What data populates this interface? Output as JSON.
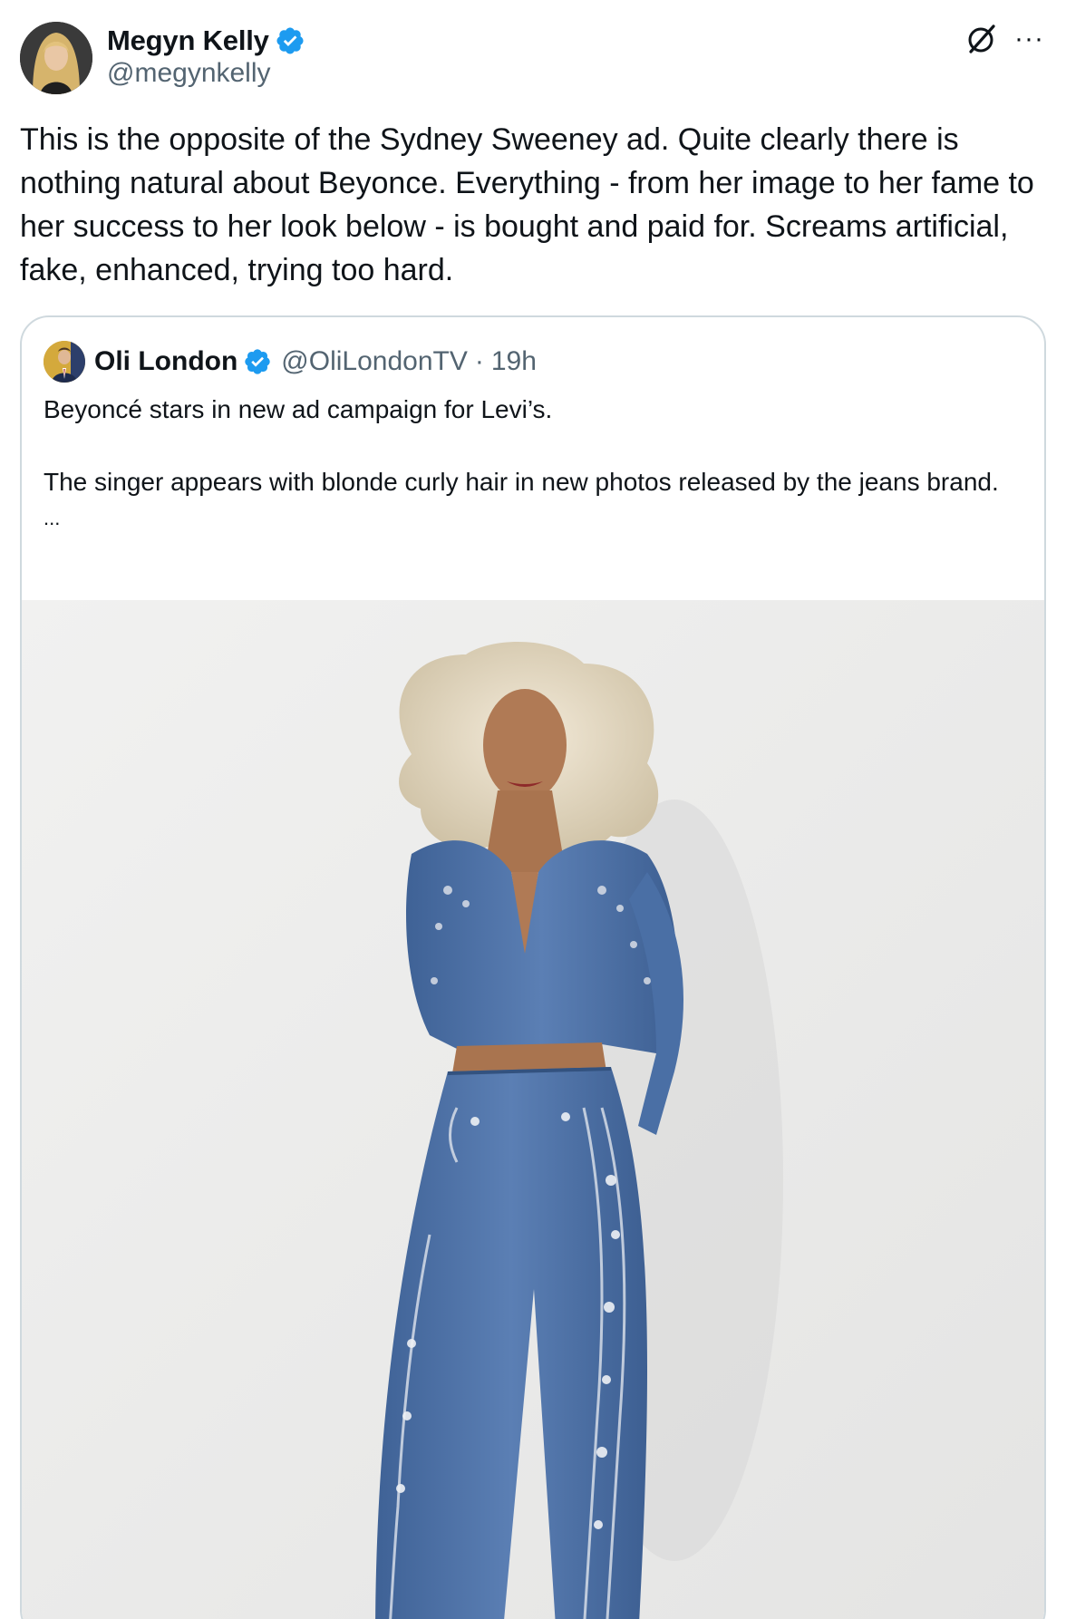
{
  "author": {
    "display_name": "Megyn Kelly",
    "handle": "@megynkelly",
    "verified": true,
    "verified_color": "#1d9bf0"
  },
  "actions": {
    "grok_icon": "grok-slash-icon",
    "more_label": "···"
  },
  "tweet": {
    "text": "This is the opposite of the Sydney Sweeney ad. Quite clearly there is nothing natural about Beyonce. Everything - from her image to her fame to her success to her look below - is bought and paid for. Screams artificial, fake, enhanced, trying too hard."
  },
  "quoted": {
    "display_name": "Oli London",
    "handle": "@OliLondonTV",
    "separator": "·",
    "time": "19h",
    "verified": true,
    "text_line1": "Beyoncé stars in new ad campaign for Levi’s.",
    "text_line2": "The singer appears with blonde curly hair in new photos released by the jeans brand.",
    "ellipsis": "...",
    "media_description_icon": "photo-denim-outfit-image"
  },
  "colors": {
    "text_primary": "#0f1419",
    "text_secondary": "#536471",
    "border": "#cfd9de",
    "denim": "#4a6fa5"
  }
}
